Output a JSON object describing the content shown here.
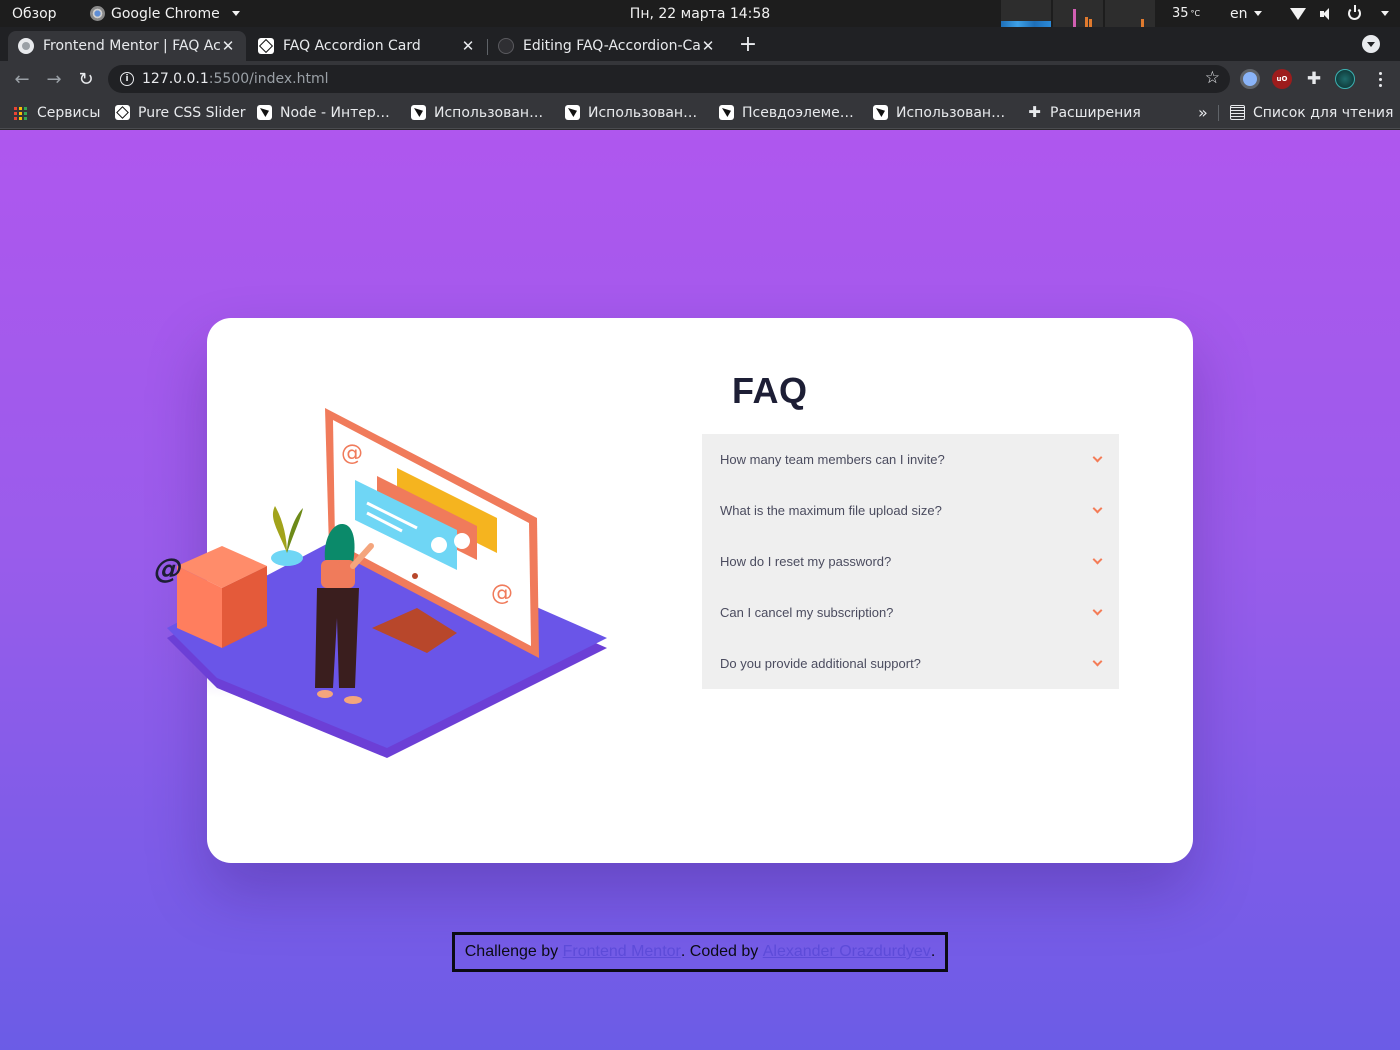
{
  "os": {
    "activities": "Обзор",
    "app_name": "Google Chrome",
    "clock": "Пн, 22 марта  14:58",
    "temperature": "35",
    "temperature_unit": "°C",
    "language": "en"
  },
  "tabs": [
    {
      "title": "Frontend Mentor | FAQ Ac",
      "active": true
    },
    {
      "title": "FAQ Accordion Card",
      "active": false
    },
    {
      "title": "Editing FAQ-Accordion-Ca",
      "active": false
    }
  ],
  "omnibox": {
    "host": "127.0.0.1",
    "path": ":5500/index.html"
  },
  "bookmarks": [
    "Сервисы",
    "Pure CSS Slider",
    "Node - Интер…",
    "Использован…",
    "Использован…",
    "Псевдоэлеме…",
    "Использован…",
    "Расширения"
  ],
  "reading_list": "Список для чтения",
  "faq": {
    "title": "FAQ",
    "questions": [
      "How many team members can I invite?",
      "What is the maximum file upload size?",
      "How do I reset my password?",
      "Can I cancel my subscription?",
      "Do you provide additional support?"
    ]
  },
  "attribution": {
    "prefix": "Challenge by ",
    "link1": "Frontend Mentor",
    "middle": ". Coded by ",
    "link2": "Alexander Orazdurdyev",
    "suffix": "."
  },
  "colors": {
    "page_gradient_top": "#af57ee",
    "page_gradient_bottom": "#6b5ce6",
    "accent_orange": "#f47c57",
    "title_dark": "#1d1e35"
  }
}
